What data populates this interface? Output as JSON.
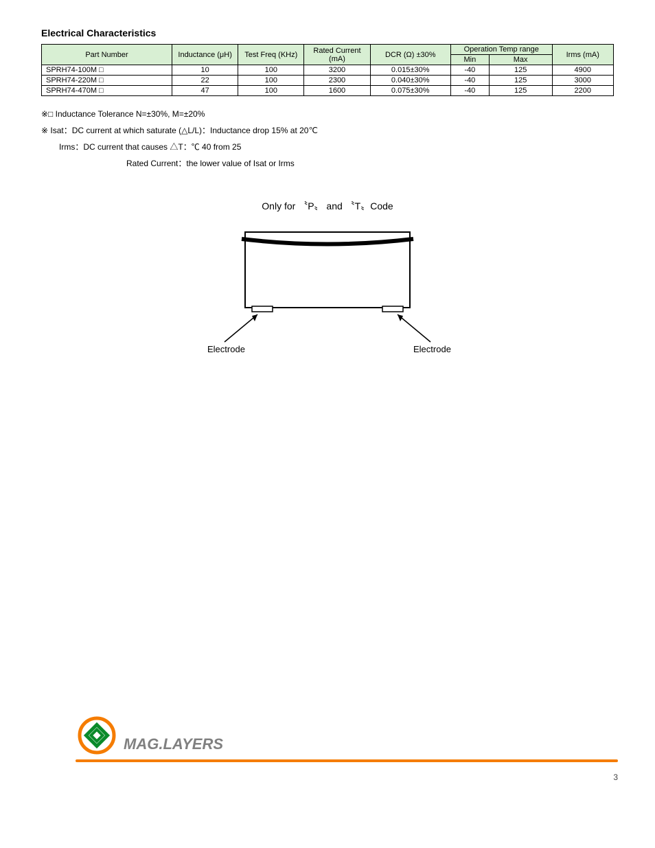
{
  "section_title": "Electrical Characteristics",
  "table": {
    "headers": {
      "part": "Part Number",
      "inductance": "Inductance (μH)",
      "test_freq": "Test Freq (KHz)",
      "rated_current": "Rated Current (mA)",
      "dcr": "DCR (Ω) ±30%",
      "temp_range": "Operation Temp range",
      "temp_min": "Min",
      "temp_max": "Max",
      "irms": "Irms (mA)"
    },
    "rows": [
      {
        "part": "SPRH74-100M □",
        "ind": "10",
        "freq": "100",
        "rated": "3200",
        "dcr": "0.015±30%",
        "tmin": "-40",
        "tmax": "125",
        "irms": "4900"
      },
      {
        "part": "SPRH74-220M □",
        "ind": "22",
        "freq": "100",
        "rated": "2300",
        "dcr": "0.040±30%",
        "tmin": "-40",
        "tmax": "125",
        "irms": "3000"
      },
      {
        "part": "SPRH74-470M □",
        "ind": "47",
        "freq": "100",
        "rated": "1600",
        "dcr": "0.075±30%",
        "tmin": "-40",
        "tmax": "125",
        "irms": "2200"
      }
    ]
  },
  "notes": {
    "n1": "※□ Inductance Tolerance N=±30%, M=±20%",
    "n2a": "※ Isat：DC current at which saturate (△L/L)：Inductance drop 15% at 20℃",
    "n2b": "Irms：DC current that causes △T：℃ 40  from 25",
    "n2c": "Rated Current：the lower value of Isat or Irms"
  },
  "diagram": {
    "title": "Only for 〝P〟 and 〝T〟Code",
    "electrode_label": "Electrode"
  },
  "footer": {
    "company": "MAG.LAYERS",
    "page": "3"
  }
}
